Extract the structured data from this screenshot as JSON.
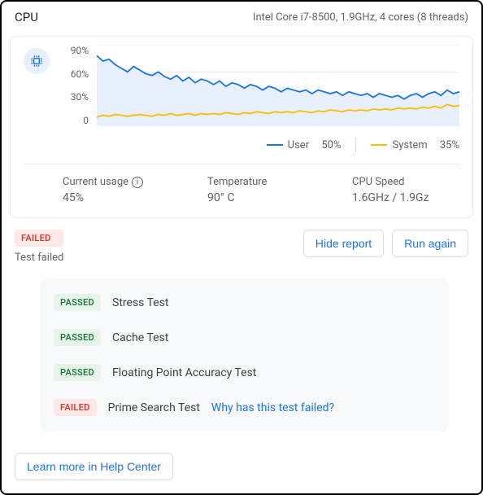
{
  "header": {
    "title": "CPU",
    "subtitle": "Intel Core i7-8500, 1.9GHz, 4 cores (8 threads)"
  },
  "chart_data": {
    "type": "line",
    "ylabel": "",
    "ylim": [
      0,
      90
    ],
    "yticks": [
      "90%",
      "60%",
      "30%",
      "0"
    ],
    "x_count": 60,
    "series": [
      {
        "name": "User",
        "color": "#1a73e8",
        "values": [
          78,
          72,
          74,
          68,
          64,
          60,
          66,
          62,
          58,
          56,
          60,
          55,
          52,
          56,
          50,
          54,
          48,
          52,
          50,
          46,
          50,
          44,
          48,
          46,
          42,
          46,
          44,
          40,
          44,
          42,
          38,
          42,
          40,
          38,
          40,
          36,
          40,
          38,
          36,
          38,
          34,
          38,
          36,
          34,
          36,
          32,
          36,
          34,
          32,
          34,
          30,
          34,
          36,
          32,
          36,
          38,
          34,
          40,
          36,
          38
        ]
      },
      {
        "name": "System",
        "color": "#fbbc04",
        "values": [
          10,
          12,
          11,
          13,
          12,
          11,
          12,
          13,
          12,
          11,
          13,
          12,
          14,
          12,
          13,
          14,
          12,
          14,
          13,
          14,
          13,
          15,
          14,
          13,
          15,
          14,
          16,
          15,
          14,
          16,
          15,
          16,
          15,
          17,
          16,
          15,
          17,
          16,
          18,
          17,
          16,
          18,
          17,
          18,
          17,
          19,
          18,
          19,
          18,
          20,
          19,
          20,
          19,
          21,
          20,
          22,
          20,
          24,
          22,
          23
        ]
      }
    ]
  },
  "legend": {
    "items": [
      {
        "label": "User",
        "value": "50%",
        "color": "#1a73e8"
      },
      {
        "label": "System",
        "value": "35%",
        "color": "#fbbc04"
      }
    ]
  },
  "metrics": [
    {
      "label": "Current usage",
      "value": "45%",
      "info": true
    },
    {
      "label": "Temperature",
      "value": "90° C"
    },
    {
      "label": "CPU Speed",
      "value": "1.6GHz / 1.9Gz"
    }
  ],
  "test": {
    "status_badge": "FAILED",
    "status_text": "Test failed",
    "actions": {
      "hide": "Hide report",
      "run": "Run again"
    },
    "items": [
      {
        "badge": "PASSED",
        "name": "Stress Test"
      },
      {
        "badge": "PASSED",
        "name": "Cache Test"
      },
      {
        "badge": "PASSED",
        "name": "Floating Point Accuracy Test"
      },
      {
        "badge": "FAILED",
        "name": "Prime Search Test",
        "link": "Why has this test failed?"
      }
    ]
  },
  "footer": {
    "help": "Learn more in Help Center"
  }
}
